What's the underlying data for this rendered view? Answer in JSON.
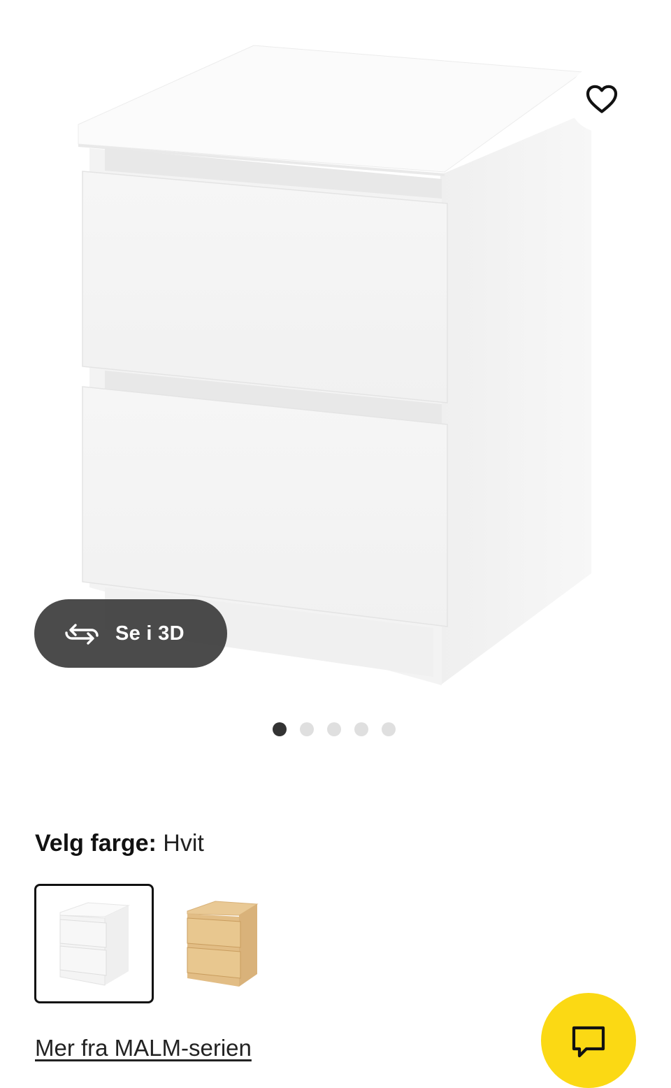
{
  "gallery": {
    "view3d_label": "Se i 3D",
    "dots": [
      true,
      false,
      false,
      false,
      false
    ]
  },
  "colors": {
    "accent_yellow": "#fbd914",
    "pill_bg": "#3c3c3c",
    "dot_active": "#333333",
    "dot_inactive": "#dfdfdf"
  },
  "color_picker": {
    "prefix": "Velg farge:",
    "selected": "Hvit",
    "options": [
      "white",
      "white-stained-oak"
    ]
  },
  "series_link": "Mer fra MALM-serien",
  "icons": {
    "favorite": "heart-icon",
    "view3d": "rotate-3d-icon",
    "chat": "chat-icon"
  }
}
